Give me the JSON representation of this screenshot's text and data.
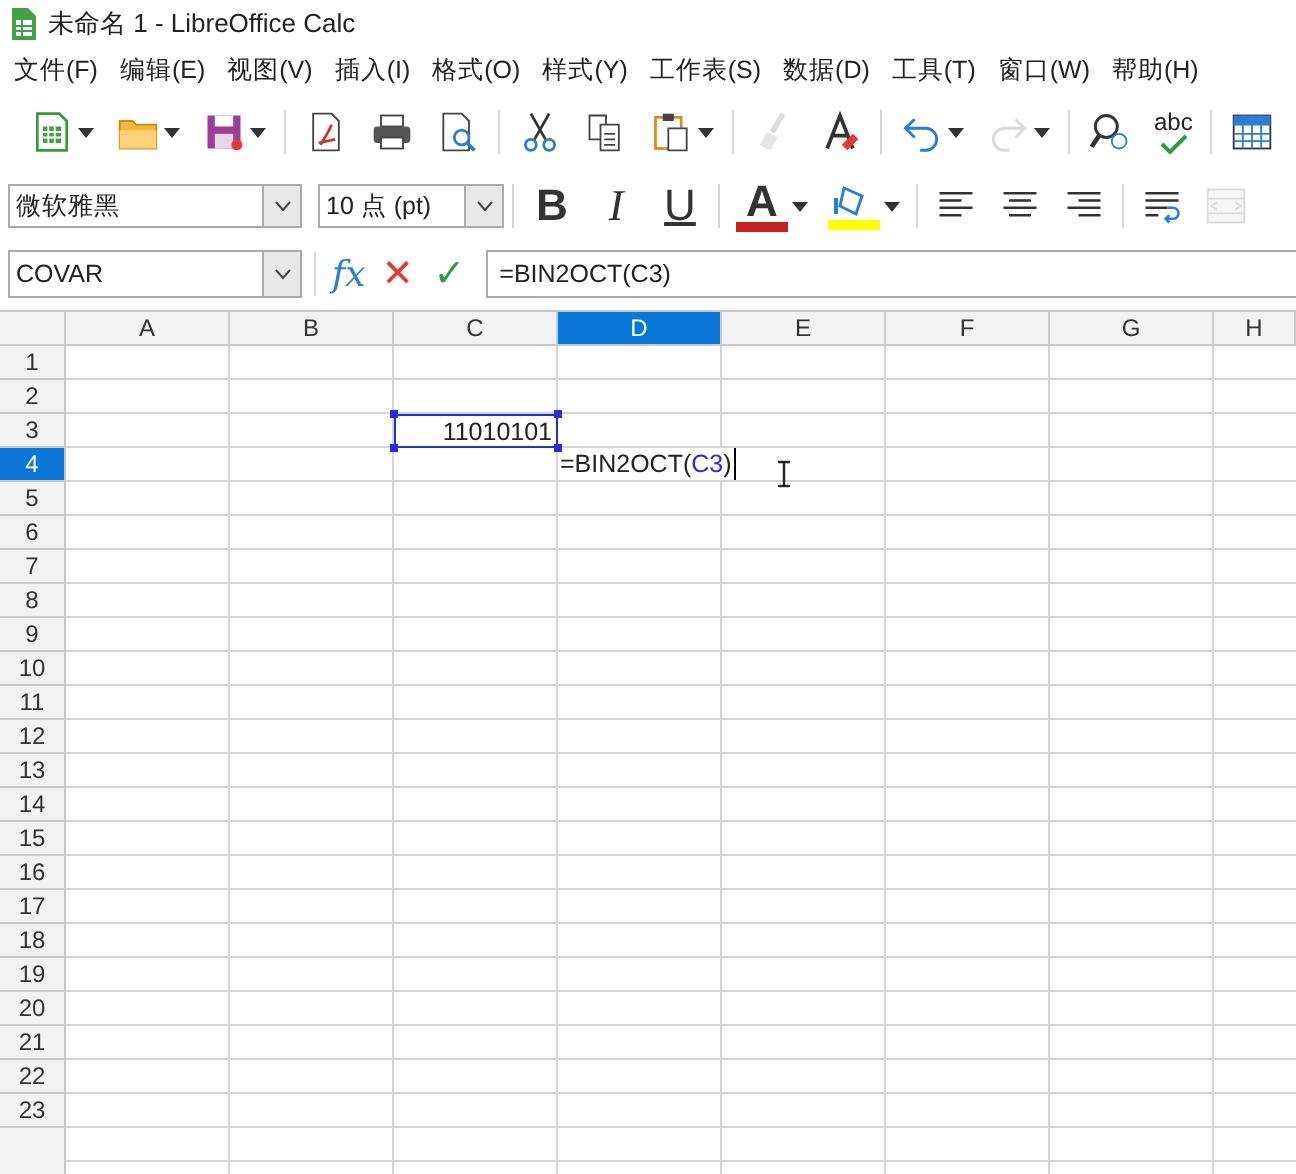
{
  "window": {
    "title": "未命名 1 - LibreOffice Calc"
  },
  "menu": [
    "文件(F)",
    "编辑(E)",
    "视图(V)",
    "插入(I)",
    "格式(O)",
    "样式(Y)",
    "工作表(S)",
    "数据(D)",
    "工具(T)",
    "窗口(W)",
    "帮助(H)"
  ],
  "standard_toolbar": {
    "groups": [
      [
        {
          "kind": "new",
          "dropdown": true,
          "disabled": false
        },
        {
          "kind": "open",
          "dropdown": true,
          "disabled": false
        },
        {
          "kind": "save",
          "dropdown": true,
          "disabled": false
        }
      ],
      [
        {
          "kind": "pdf",
          "disabled": false
        },
        {
          "kind": "print",
          "disabled": false
        },
        {
          "kind": "preview",
          "disabled": false
        }
      ],
      [
        {
          "kind": "cut",
          "disabled": false
        },
        {
          "kind": "copy",
          "disabled": false
        },
        {
          "kind": "paste",
          "dropdown": true,
          "disabled": false
        }
      ],
      [
        {
          "kind": "clone",
          "disabled": true
        },
        {
          "kind": "clear",
          "disabled": false
        }
      ],
      [
        {
          "kind": "undo",
          "dropdown": true,
          "disabled": false
        },
        {
          "kind": "redo",
          "dropdown": true,
          "disabled": true
        }
      ],
      [
        {
          "kind": "find",
          "disabled": false
        },
        {
          "kind": "spelling",
          "label": "abc",
          "disabled": false
        }
      ],
      [
        {
          "kind": "grid",
          "disabled": false
        }
      ]
    ]
  },
  "formatting_toolbar": {
    "font_name": "微软雅黑",
    "font_size": "10 点 (pt)",
    "groups": [
      [
        {
          "kind": "bold",
          "label": "B",
          "disabled": false
        },
        {
          "kind": "italic",
          "label": "I",
          "disabled": false
        },
        {
          "kind": "underline",
          "label": "U",
          "disabled": false
        }
      ],
      [
        {
          "kind": "font-color",
          "label": "A",
          "color": "#c9211e",
          "dropdown": true,
          "disabled": false
        },
        {
          "kind": "highlight",
          "color": "#ffff00",
          "dropdown": true,
          "disabled": false
        }
      ],
      [
        {
          "kind": "align-left",
          "disabled": false
        },
        {
          "kind": "align-center",
          "disabled": false
        },
        {
          "kind": "align-right",
          "disabled": false
        }
      ],
      [
        {
          "kind": "wrap",
          "disabled": false
        },
        {
          "kind": "merge",
          "disabled": true
        }
      ]
    ]
  },
  "formula_bar": {
    "name_box": "COVAR",
    "function_wizard": "fx",
    "cancel": "✕",
    "accept": "✓",
    "input": "=BIN2OCT(C3)"
  },
  "sheet": {
    "columns": [
      {
        "label": "A",
        "selected": false
      },
      {
        "label": "B",
        "selected": false
      },
      {
        "label": "C",
        "selected": false
      },
      {
        "label": "D",
        "selected": true
      },
      {
        "label": "E",
        "selected": false
      },
      {
        "label": "F",
        "selected": false
      },
      {
        "label": "G",
        "selected": false
      },
      {
        "label": "H",
        "selected": false
      }
    ],
    "rows": [
      {
        "label": "1",
        "selected": false
      },
      {
        "label": "2",
        "selected": false
      },
      {
        "label": "3",
        "selected": false,
        "cells": [
          null,
          null,
          {
            "kind": "value",
            "text": "11010101",
            "referenced": true
          }
        ]
      },
      {
        "label": "4",
        "selected": true,
        "cells": [
          null,
          null,
          null,
          {
            "kind": "editing",
            "parts": [
              {
                "text": "=BIN2OCT(",
                "reference": false
              },
              {
                "text": "C3",
                "reference": true
              },
              {
                "text": ")",
                "reference": false
              }
            ]
          }
        ]
      },
      {
        "label": "5",
        "selected": false
      },
      {
        "label": "6",
        "selected": false
      },
      {
        "label": "7",
        "selected": false
      },
      {
        "label": "8",
        "selected": false
      },
      {
        "label": "9",
        "selected": false
      },
      {
        "label": "10",
        "selected": false
      },
      {
        "label": "11",
        "selected": false
      },
      {
        "label": "12",
        "selected": false
      },
      {
        "label": "13",
        "selected": false
      },
      {
        "label": "14",
        "selected": false
      },
      {
        "label": "15",
        "selected": false
      },
      {
        "label": "16",
        "selected": false
      },
      {
        "label": "17",
        "selected": false
      },
      {
        "label": "18",
        "selected": false
      },
      {
        "label": "19",
        "selected": false
      },
      {
        "label": "20",
        "selected": false
      },
      {
        "label": "21",
        "selected": false
      },
      {
        "label": "22",
        "selected": false
      },
      {
        "label": "23",
        "selected": false
      }
    ]
  }
}
